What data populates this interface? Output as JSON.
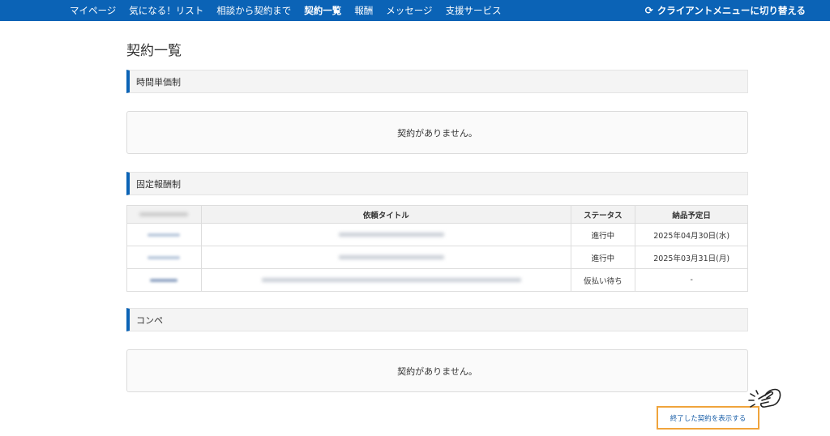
{
  "nav": {
    "items": [
      "マイページ",
      "気になる！リスト",
      "相談から契約まで",
      "契約一覧",
      "報酬",
      "メッセージ",
      "支援サービス"
    ],
    "active_index": 3,
    "switch_label": "クライアントメニューに切り替える",
    "switch_icon": "refresh-icon"
  },
  "page": {
    "title": "契約一覧"
  },
  "sections": {
    "hourly": {
      "title": "時間単価制",
      "empty_message": "契約がありません。"
    },
    "fixed": {
      "title": "固定報酬制",
      "table": {
        "headers": [
          "",
          "依頼タイトル",
          "ステータス",
          "納品予定日"
        ],
        "rows": [
          {
            "status": "進行中",
            "due": "2025年04月30日(水)"
          },
          {
            "status": "進行中",
            "due": "2025年03月31日(月)"
          },
          {
            "status": "仮払い待ち",
            "due": "-"
          }
        ]
      }
    },
    "compe": {
      "title": "コンペ",
      "empty_message": "契約がありません。"
    }
  },
  "footer": {
    "ended_link": "終了した契約を表示する",
    "pointer_icon": "pointing-hand-icon"
  },
  "colors": {
    "nav_bg": "#0b63b6",
    "accent": "#0b63b6",
    "highlight_border": "#f0a43c",
    "link": "#1a5fa8"
  }
}
